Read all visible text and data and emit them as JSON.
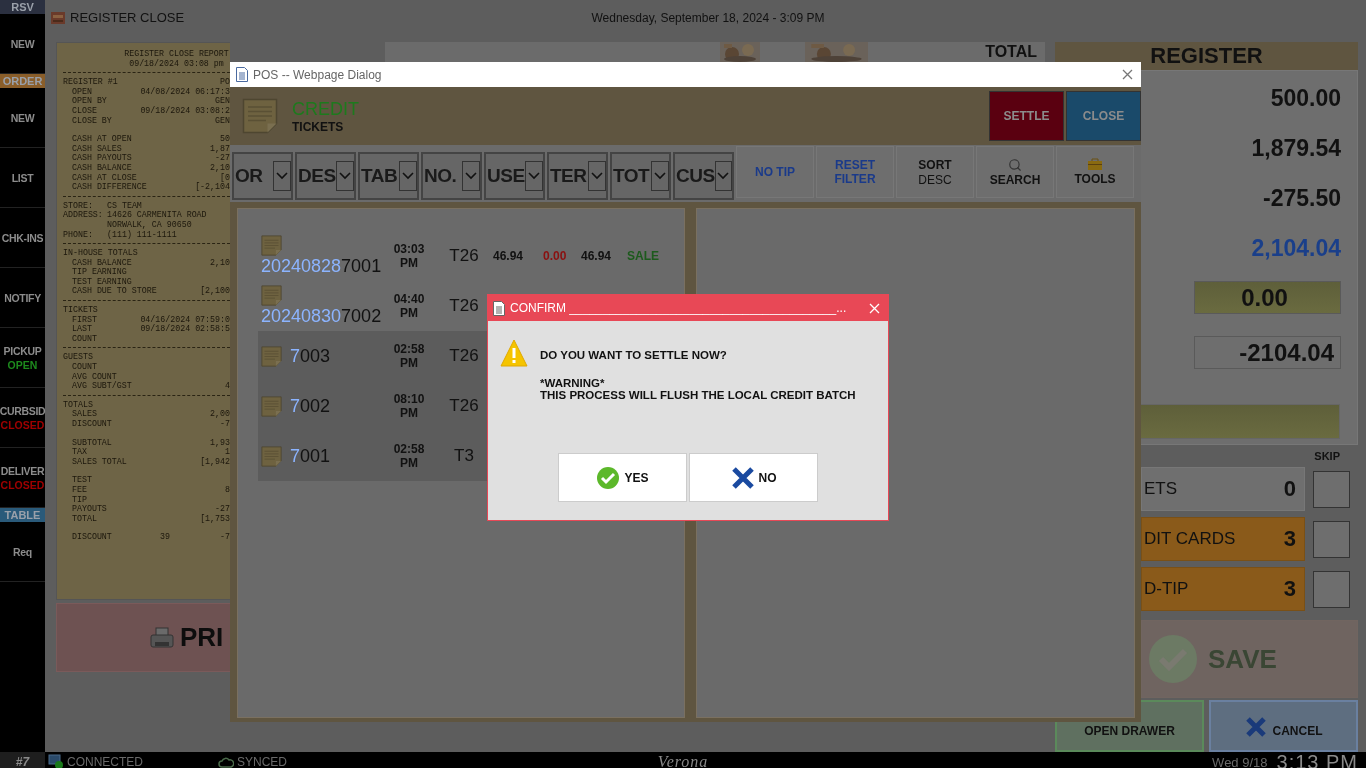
{
  "sidebar": [
    {
      "kind": "header",
      "label": "RSV",
      "color": "#2b3040"
    },
    {
      "kind": "item",
      "label": "NEW"
    },
    {
      "kind": "header",
      "label": "ORDER",
      "color": "#8a5e2a"
    },
    {
      "kind": "item",
      "label": "NEW"
    },
    {
      "kind": "item",
      "label": "LIST"
    },
    {
      "kind": "item",
      "label": "CHK-INS"
    },
    {
      "kind": "item",
      "label": "NOTIFY"
    },
    {
      "kind": "item",
      "label": "PICKUP",
      "status": "OPEN",
      "open": true
    },
    {
      "kind": "item",
      "label": "CURBSID",
      "status": "CLOSED",
      "open": false
    },
    {
      "kind": "item",
      "label": "DELIVER",
      "status": "CLOSED",
      "open": false
    },
    {
      "kind": "header",
      "label": "TABLE",
      "color": "#2a5a7a"
    },
    {
      "kind": "item",
      "label": "Req"
    }
  ],
  "top_bar": {
    "title": "REGISTER CLOSE",
    "datetime": "Wednesday, September 18, 2024 - 3:09 PM"
  },
  "receipt": {
    "title": "REGISTER CLOSE REPORT",
    "date": "09/18/2024 03:08 pm",
    "sections": [
      {
        "kind": "block",
        "heading": "REGISTER #1",
        "heading_value": "PO",
        "lines": [
          {
            "label": "OPEN",
            "value": "04/08/2024 06:17:3"
          },
          {
            "label": "OPEN BY",
            "value": "GEN"
          },
          {
            "label": "CLOSE",
            "value": "09/18/2024 03:08:2"
          },
          {
            "label": "CLOSE BY",
            "value": "GEN"
          },
          {
            "kind": "gap"
          },
          {
            "label": "CASH AT OPEN",
            "value": "50"
          },
          {
            "label": "CASH SALES",
            "value": "1,87"
          },
          {
            "label": "CASH PAYOUTS",
            "value": "-27"
          },
          {
            "label": "CASH BALANCE",
            "value": "2,10"
          },
          {
            "label": "CASH AT CLOSE",
            "value": "[0"
          },
          {
            "label": "CASH DIFFERENCE",
            "value": "[-2,104"
          }
        ]
      },
      {
        "kind": "info",
        "lines": [
          {
            "label": "STORE:",
            "value": "CS TEAM"
          },
          {
            "label": "ADDRESS:",
            "value": "14626 CARMENITA ROAD"
          },
          {
            "value": "NORWALK, CA 90650"
          },
          {
            "label": "PHONE:",
            "value": "(111) 111-1111"
          }
        ]
      },
      {
        "kind": "block",
        "heading": "IN-HOUSE TOTALS",
        "lines": [
          {
            "label": "CASH BALANCE",
            "value": "2,10"
          },
          {
            "label": "TIP EARNING"
          },
          {
            "label": "TEST EARNING"
          },
          {
            "label": "CASH DUE TO STORE",
            "value": "[2,100"
          }
        ]
      },
      {
        "kind": "block",
        "heading": "TICKETS",
        "lines": [
          {
            "label": "FIRST",
            "value": "04/16/2024 07:59:0"
          },
          {
            "label": "LAST",
            "value": "09/18/2024 02:58:5"
          },
          {
            "label": "COUNT"
          }
        ]
      },
      {
        "kind": "block",
        "heading": "GUESTS",
        "lines": [
          {
            "label": "COUNT"
          },
          {
            "label": "AVG COUNT"
          },
          {
            "label": "AVG SUBT/GST",
            "value": "4"
          }
        ]
      },
      {
        "kind": "block",
        "heading": "TOTALS",
        "lines": [
          {
            "label": "SALES",
            "value": "2,00"
          },
          {
            "label": "DISCOUNT",
            "value": "-7"
          },
          {
            "kind": "gap"
          },
          {
            "label": "SUBTOTAL",
            "value": "1,93"
          },
          {
            "label": "TAX",
            "value": "1"
          },
          {
            "label": "SALES TOTAL",
            "value": "[1,942"
          },
          {
            "kind": "gap"
          },
          {
            "label": "TEST"
          },
          {
            "label": "FEE",
            "value": "8"
          },
          {
            "label": "TIP"
          },
          {
            "label": "PAYOUTS",
            "value": "-27"
          },
          {
            "label": "TOTAL",
            "value": "[1,753"
          },
          {
            "kind": "gap"
          },
          {
            "label": "DISCOUNT",
            "mid": "39",
            "value": "-7"
          }
        ]
      }
    ]
  },
  "print_button": {
    "label": "PRI"
  },
  "total_panel": {
    "title": "TOTAL"
  },
  "pos_dialog": {
    "title": "POS -- Webpage Dialog",
    "heading": "CREDIT",
    "subheading": "TICKETS",
    "actions": [
      {
        "label": "SETTLE",
        "kind": "settle"
      },
      {
        "label": "CLOSE",
        "kind": "close"
      }
    ],
    "filters": [
      "OR",
      "DES",
      "TAB",
      "NO.",
      "USE",
      "TER",
      "TOT",
      "CUS"
    ],
    "tools": [
      {
        "label": "NO TIP",
        "kind": "link"
      },
      {
        "label": "RESET FILTER",
        "kind": "link"
      },
      {
        "label": "SORT",
        "sublabel": "DESC",
        "kind": "plain"
      },
      {
        "label": "SEARCH",
        "kind": "search"
      },
      {
        "label": "TOOLS",
        "kind": "tools"
      }
    ],
    "tickets": [
      {
        "kind": "dated",
        "prefix": "20240828",
        "number": "7001",
        "time": "03:03 PM",
        "table": "T26",
        "amount": "46.94",
        "tip": "0.00",
        "total": "46.94",
        "type": "SALE",
        "selected": false
      },
      {
        "kind": "dated",
        "prefix": "20240830",
        "number": "7002",
        "time": "04:40 PM",
        "table": "T26",
        "selected": false
      },
      {
        "kind": "short",
        "prefix": "7",
        "number": "003",
        "time": "02:58 PM",
        "table": "T26",
        "selected": true
      },
      {
        "kind": "short",
        "prefix": "7",
        "number": "002",
        "time": "08:10 PM",
        "table": "T26",
        "selected": true
      },
      {
        "kind": "short",
        "prefix": "7",
        "number": "001",
        "time": "02:58 PM",
        "table": "T3",
        "selected": true
      }
    ]
  },
  "confirm": {
    "title": "CONFIRM ________________________________________...",
    "question": "DO YOU WANT TO SETTLE NOW?",
    "warning": "*WARNING*",
    "detail": "THIS PROCESS WILL FLUSH THE LOCAL CREDIT BATCH",
    "buttons": [
      {
        "label": "YES",
        "kind": "yes"
      },
      {
        "label": "NO",
        "kind": "no"
      }
    ]
  },
  "register": {
    "header": "REGISTER",
    "values": [
      {
        "text": "500.00",
        "kind": "plain"
      },
      {
        "text": "1,879.54",
        "kind": "plain"
      },
      {
        "text": "-275.50",
        "kind": "plain"
      },
      {
        "text": "2,104.04",
        "kind": "total"
      }
    ],
    "fields": [
      {
        "value": "0.00",
        "kind": "highlight"
      },
      {
        "value": "-2104.04",
        "kind": "outline"
      }
    ],
    "skip_label": "SKIP",
    "counts": [
      {
        "label": "ETS",
        "count": "0",
        "kind": "plain",
        "checked": false
      },
      {
        "label": "DIT CARDS",
        "count": "3",
        "kind": "orange",
        "checked": false
      },
      {
        "label": "D-TIP",
        "count": "3",
        "kind": "orange",
        "checked": false
      }
    ],
    "save": {
      "label": "SAVE",
      "disabled": true
    },
    "bottom_buttons": [
      {
        "label": "OPEN DRAWER",
        "kind": "drawer"
      },
      {
        "label": "CANCEL",
        "kind": "cancel"
      }
    ]
  },
  "status_bar": {
    "terminal": "#7",
    "connection": "CONNECTED",
    "sync": "SYNCED",
    "store": "Verona",
    "date": "Wed 9/18",
    "time": "3:13 PM"
  }
}
